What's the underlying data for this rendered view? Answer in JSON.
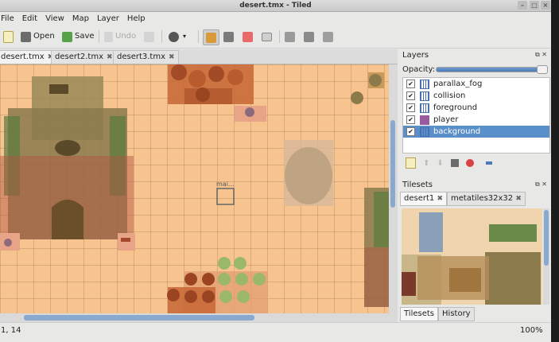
{
  "window": {
    "title": "desert.tmx - Tiled"
  },
  "menu": [
    "File",
    "Edit",
    "View",
    "Map",
    "Layer",
    "Help"
  ],
  "toolbar": {
    "open_label": "Open",
    "save_label": "Save",
    "undo_label": "Undo"
  },
  "tabs": [
    {
      "label": "desert.tmx",
      "close": "✖"
    },
    {
      "label": "desert2.tmx",
      "close": "✖"
    },
    {
      "label": "desert3.tmx",
      "close": "✖"
    }
  ],
  "map": {
    "cursor_label": "mai..."
  },
  "layers_panel": {
    "title": "Layers",
    "opacity_label": "Opacity:",
    "opacity_value": 1.0,
    "layers": [
      {
        "name": "parallax_fog",
        "icon": "tile-layer-icon",
        "checked": true,
        "selected": false
      },
      {
        "name": "collision",
        "icon": "tile-layer-icon",
        "checked": true,
        "selected": false
      },
      {
        "name": "foreground",
        "icon": "tile-layer-icon",
        "checked": true,
        "selected": false
      },
      {
        "name": "player",
        "icon": "object-layer-icon",
        "checked": true,
        "selected": false
      },
      {
        "name": "background",
        "icon": "tile-layer-icon",
        "checked": true,
        "selected": true
      }
    ]
  },
  "tilesets_panel": {
    "title": "Tilesets",
    "tabs": [
      {
        "label": "desert1",
        "close": "✖"
      },
      {
        "label": "metatiles32x32",
        "close": "✖"
      }
    ]
  },
  "dock_tabs": [
    "Tilesets",
    "History"
  ],
  "status": {
    "coords": "1, 14",
    "zoom": "100%"
  },
  "colors": {
    "selection": "#5b8fc9",
    "sand": "#f7c48f",
    "scroll_thumb": "#8aa9cf"
  }
}
